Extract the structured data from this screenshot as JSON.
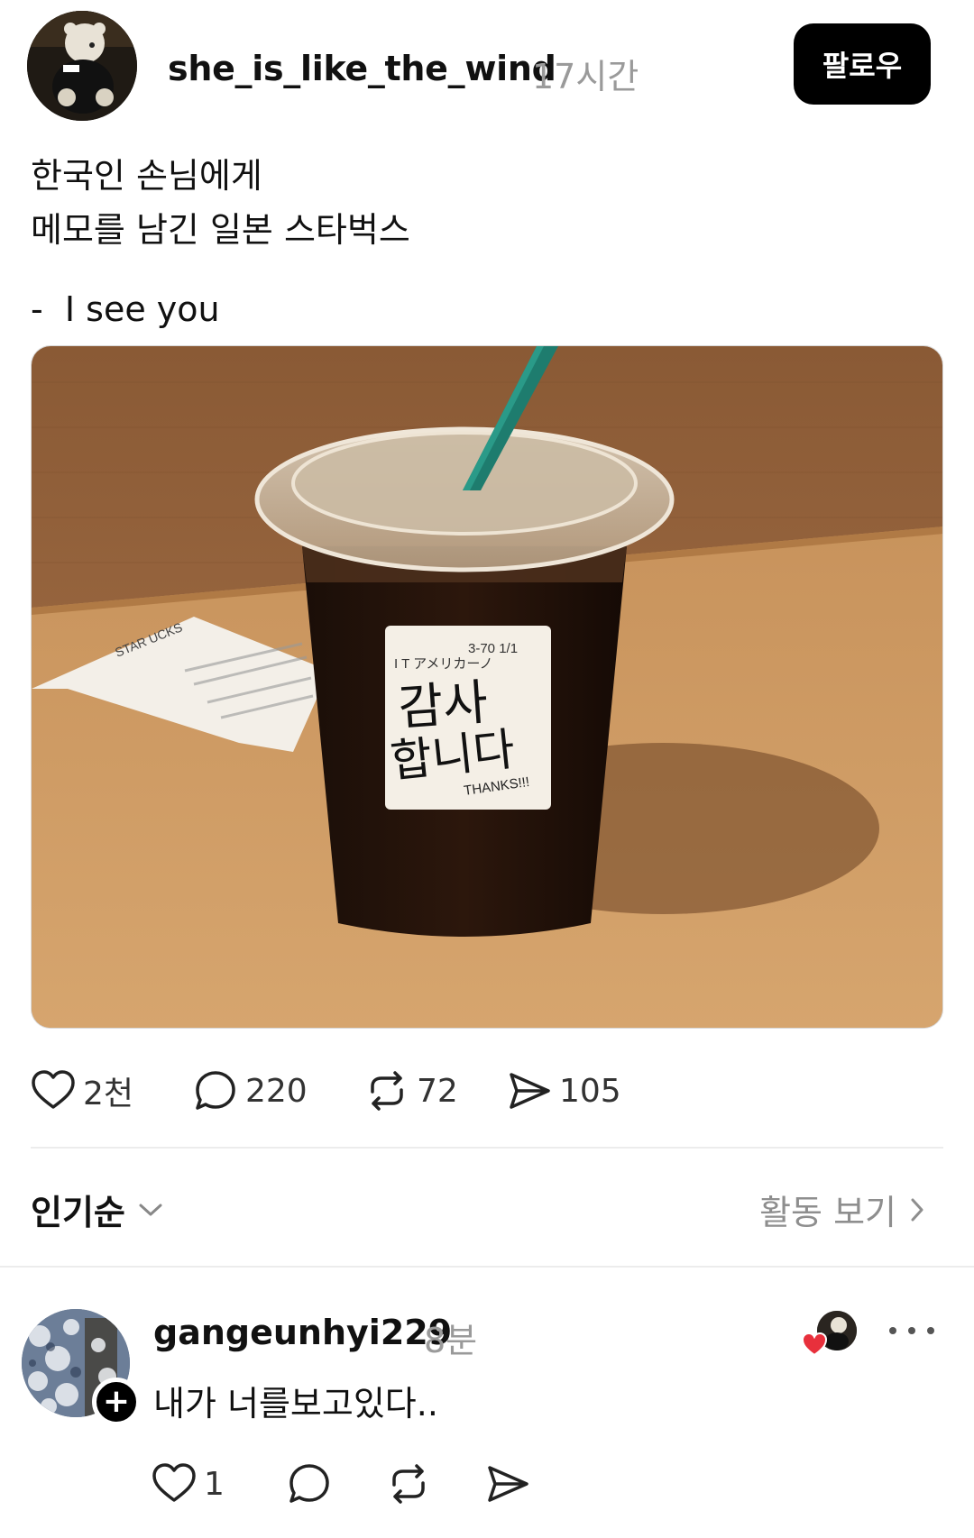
{
  "post": {
    "username": "she_is_like_the_wind",
    "time": "17시간",
    "follow_label": "팔로우",
    "caption_lines": [
      "한국인 손님에게",
      "메모를 남긴 일본 스타벅스"
    ],
    "caption_tail": "-  I see you",
    "photo": {
      "sticker_code": "3-70   1/1",
      "sticker_item": "I  T  アメリカーノ",
      "sticker_text_1": "감사",
      "sticker_text_2": "합니다",
      "sticker_thanks": "THANKS!!!",
      "receipt_text": "STAR  UCKS"
    },
    "stats": {
      "likes": "2천",
      "comments": "220",
      "reposts": "72",
      "shares": "105"
    }
  },
  "sort": {
    "label": "인기순",
    "activity_label": "활동 보기"
  },
  "comment": {
    "username": "gangeunhyi229",
    "time": "8분",
    "text": "내가 너를보고있다..",
    "likes": "1"
  },
  "icons": {
    "like": "heart-icon",
    "comment": "comment-bubble-icon",
    "repost": "repost-icon",
    "share": "send-icon",
    "sort": "chevron-down-icon",
    "activity": "chevron-right-icon",
    "more": "more-icon",
    "follow_badge": "plus-icon"
  },
  "colors": {
    "follow_bg": "#000000",
    "muted_text": "#9a9a9a",
    "heart_red": "#e8303c"
  }
}
